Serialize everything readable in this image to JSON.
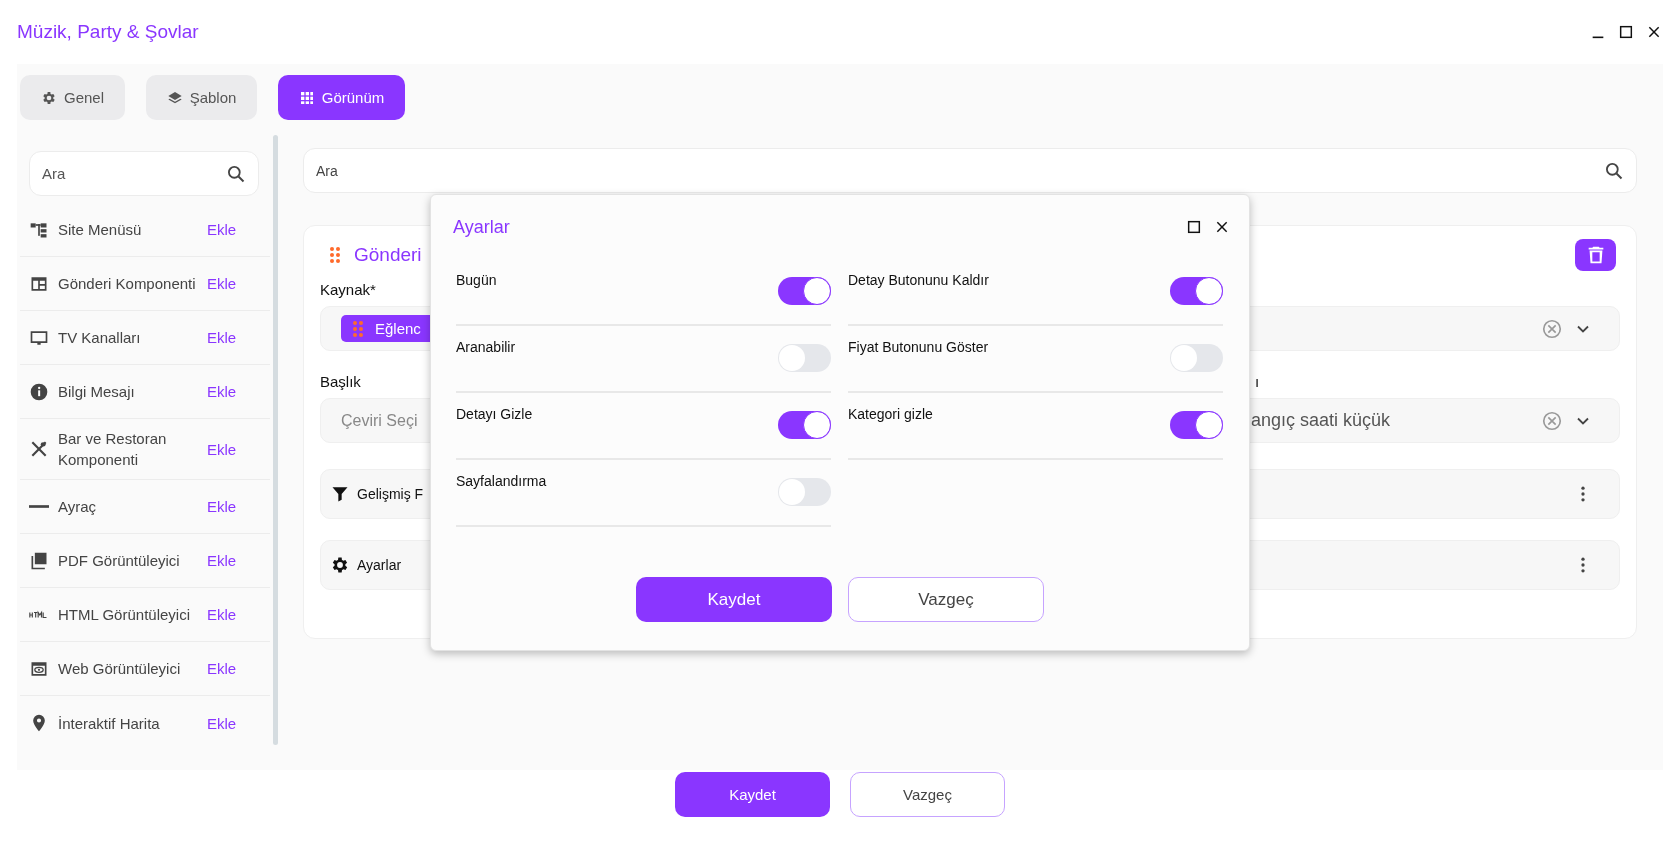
{
  "window": {
    "title": "Müzik, Party & Şovlar"
  },
  "tabs": [
    {
      "label": "Genel",
      "selected": false
    },
    {
      "label": "Şablon",
      "selected": false
    },
    {
      "label": "Görünüm",
      "selected": true
    }
  ],
  "sidebar": {
    "search": {
      "placeholder": "Ara"
    },
    "items": [
      {
        "label": "Site Menüsü",
        "action": "Ekle"
      },
      {
        "label": "Gönderi Komponenti",
        "action": "Ekle"
      },
      {
        "label": "TV Kanalları",
        "action": "Ekle"
      },
      {
        "label": "Bilgi Mesajı",
        "action": "Ekle"
      },
      {
        "label": "Bar ve Restoran Komponenti",
        "action": "Ekle"
      },
      {
        "label": "Ayraç",
        "action": "Ekle"
      },
      {
        "label": "PDF Görüntüleyici",
        "action": "Ekle"
      },
      {
        "label": "HTML Görüntüleyici",
        "action": "Ekle"
      },
      {
        "label": "Web Görüntüleyici",
        "action": "Ekle"
      },
      {
        "label": "İnteraktif Harita",
        "action": "Ekle"
      }
    ]
  },
  "main": {
    "search": {
      "placeholder": "Ara"
    },
    "card": {
      "title": "Gönderi",
      "source": {
        "label": "Kaynak*",
        "chip": "Eğlenc"
      },
      "title_field": {
        "label": "Başlık",
        "placeholder": "Çeviri Seçi"
      },
      "sort_field": {
        "label": "ı",
        "value": "angıç saati küçük"
      },
      "sections": [
        {
          "label": "Gelişmiş F"
        },
        {
          "label": "Ayarlar"
        }
      ]
    }
  },
  "dialog": {
    "title": "Ayarlar",
    "options": [
      {
        "label": "Bugün",
        "on": true
      },
      {
        "label": "Detay Butonunu Kaldır",
        "on": true
      },
      {
        "label": "Aranabilir",
        "on": false
      },
      {
        "label": "Fiyat Butonunu Göster",
        "on": false
      },
      {
        "label": "Detayı Gizle",
        "on": true
      },
      {
        "label": "Kategori gizle",
        "on": true
      },
      {
        "label": "Sayfalandırma",
        "on": false
      }
    ],
    "buttons": [
      {
        "label": "Kaydet",
        "kind": "primary"
      },
      {
        "label": "Vazgeç",
        "kind": "secondary"
      }
    ]
  },
  "buttons": [
    {
      "label": "Kaydet",
      "kind": "primary"
    },
    {
      "label": "Vazgeç",
      "kind": "secondary"
    }
  ]
}
